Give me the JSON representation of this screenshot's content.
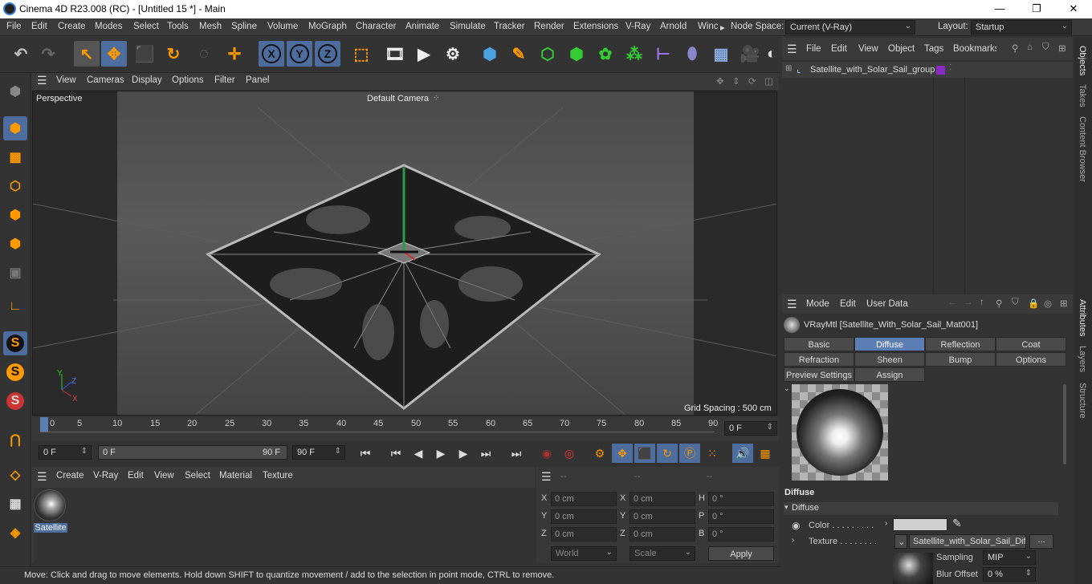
{
  "window": {
    "title": "Cinema 4D R23.008 (RC) - [Untitled 15 *] - Main",
    "min": "—",
    "max": "❐",
    "close": "✕"
  },
  "menubar": {
    "items": [
      "File",
      "Edit",
      "Create",
      "Modes",
      "Select",
      "Tools",
      "Mesh",
      "Spline",
      "Volume",
      "MoGraph",
      "Character",
      "Animate",
      "Simulate",
      "Tracker",
      "Render",
      "Extensions",
      "V-Ray",
      "Arnold",
      "Winc"
    ],
    "more": "▸",
    "node_space_label": "Node Space:",
    "node_space_value": "Current (V-Ray)",
    "layout_label": "Layout:",
    "layout_value": "Startup"
  },
  "toolbar": {
    "axis_x": "X",
    "axis_y": "Y",
    "axis_z": "Z"
  },
  "viewport": {
    "menu": [
      "View",
      "Cameras",
      "Display",
      "Options",
      "Filter",
      "Panel"
    ],
    "name": "Perspective",
    "camera": "Default Camera",
    "grid_spacing": "Grid Spacing : 500 cm",
    "axis_x": "X",
    "axis_y": "Y",
    "axis_z": "Z"
  },
  "timeline": {
    "ticks": [
      "0",
      "5",
      "10",
      "15",
      "20",
      "25",
      "30",
      "35",
      "40",
      "45",
      "50",
      "55",
      "60",
      "65",
      "70",
      "75",
      "80",
      "85",
      "90"
    ],
    "current_frame": "0 F"
  },
  "transport": {
    "start": "0 F",
    "range_start": "0 F",
    "range_end": "90 F",
    "end": "90 F"
  },
  "material_manager": {
    "menu": [
      "Create",
      "V-Ray",
      "Edit",
      "View",
      "Select",
      "Material",
      "Texture"
    ],
    "material_name": "Satellite"
  },
  "coords": {
    "col_headers": [
      "--",
      "--",
      "--"
    ],
    "rows": [
      {
        "a": "X",
        "av": "0 cm",
        "b": "X",
        "bv": "0 cm",
        "c": "H",
        "cv": "0 °"
      },
      {
        "a": "Y",
        "av": "0 cm",
        "b": "Y",
        "bv": "0 cm",
        "c": "P",
        "cv": "0 °"
      },
      {
        "a": "Z",
        "av": "0 cm",
        "b": "Z",
        "bv": "0 cm",
        "c": "B",
        "cv": "0 °"
      }
    ],
    "mode1": "World",
    "mode2": "Scale",
    "apply": "Apply"
  },
  "status": {
    "text": "Move: Click and drag to move elements. Hold down SHIFT to quantize movement / add to the selection in point mode, CTRL to remove."
  },
  "objects": {
    "menu": [
      "File",
      "Edit",
      "View",
      "Object",
      "Tags",
      "Bookmarks"
    ],
    "items": [
      {
        "name": "Satellite_with_Solar_Sail_group",
        "tag_color": "#8a2bc8"
      }
    ]
  },
  "right_tabs": [
    "Objects",
    "Takes",
    "Content Browser",
    "Attributes",
    "Layers",
    "Structure"
  ],
  "attributes": {
    "menu": [
      "Mode",
      "Edit",
      "User Data"
    ],
    "material_title": "VRayMtl [Satellite_With_Solar_Sail_Mat001]",
    "tabs_row1": [
      "Basic",
      "Diffuse",
      "Reflection",
      "Coat"
    ],
    "tabs_row2": [
      "Refraction",
      "Sheen",
      "Bump",
      "Options"
    ],
    "tabs_row3": [
      "Preview Settings",
      "Assign"
    ],
    "section": "Diffuse",
    "subsection": "Diffuse",
    "color_label": "Color . . . . . . . . .",
    "texture_label": "Texture . . . . . . . .",
    "texture_value": "Satellite_with_Solar_Sail_Diff",
    "texture_btn": "...",
    "sampling_label": "Sampling",
    "sampling_value": "MIP",
    "blur_label": "Blur Offset",
    "blur_value": "0 %"
  }
}
